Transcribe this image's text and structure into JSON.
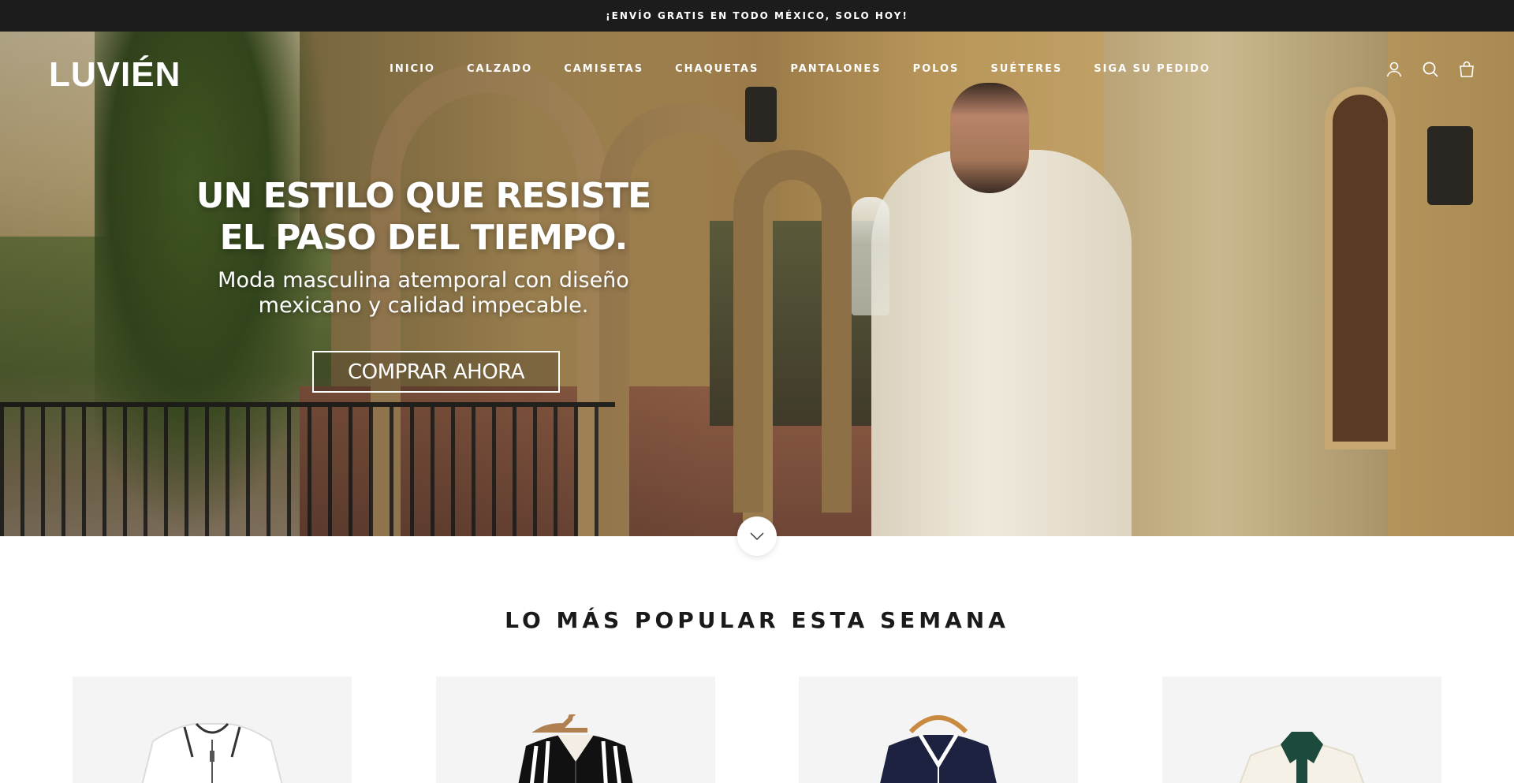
{
  "announcement": {
    "text": "¡ENVÍO GRATIS EN TODO MÉXICO, SOLO HOY!"
  },
  "header": {
    "logo": "LUVIÉN",
    "nav": [
      {
        "label": "INICIO"
      },
      {
        "label": "CALZADO"
      },
      {
        "label": "CAMISETAS"
      },
      {
        "label": "CHAQUETAS"
      },
      {
        "label": "PANTALONES"
      },
      {
        "label": "POLOS"
      },
      {
        "label": "SUÉTERES"
      },
      {
        "label": "SIGA SU PEDIDO"
      }
    ],
    "icons": [
      "account-icon",
      "search-icon",
      "cart-icon"
    ]
  },
  "hero": {
    "title_line1": "UN ESTILO QUE RESISTE",
    "title_line2": "EL PASO DEL TIEMPO.",
    "subtitle_line1": "Moda masculina atemporal con diseño",
    "subtitle_line2": "mexicano y calidad impecable.",
    "cta": "COMPRAR AHORA"
  },
  "scroll_icon": "chevron-down-icon",
  "popular": {
    "title": "LO MÁS POPULAR ESTA SEMANA",
    "products": [
      {
        "image": "white-zip-polo-shirt"
      },
      {
        "image": "black-white-striped-polo-shirt"
      },
      {
        "image": "navy-polo-shirt-white-trim"
      },
      {
        "image": "cream-polo-shirt-green-collar"
      }
    ]
  },
  "colors": {
    "announcement_bg": "#1c1c1c",
    "text_dark": "#1a1a1a",
    "card_bg": "#f4f4f4",
    "white": "#ffffff"
  }
}
